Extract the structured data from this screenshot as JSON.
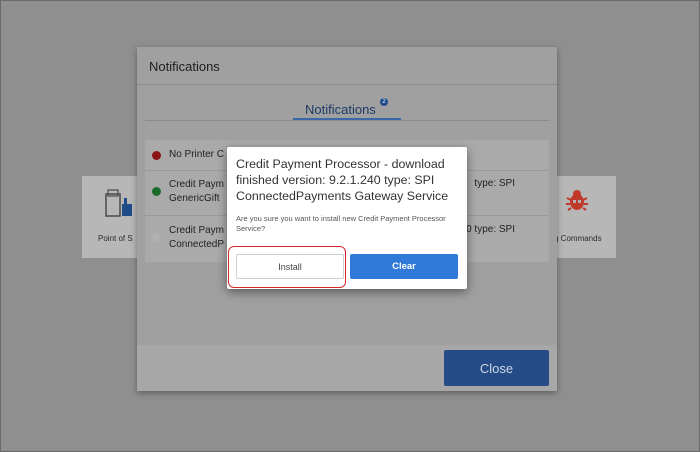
{
  "panel": {
    "title": "Notifications",
    "tab_label": "Notifications",
    "tab_badge": "2",
    "close_label": "Close",
    "rows": [
      {
        "text": "No Printer C",
        "right": "",
        "dot_color": "#8b1414"
      },
      {
        "text": "Credit Paym",
        "text2": "GenericGift",
        "right": "type: SPI",
        "dot_color": "#1b6b2a"
      },
      {
        "text": "Credit Paym",
        "text2": "ConnectedP",
        "right": "0 type: SPI",
        "dot_color": "#b0b0b0"
      }
    ]
  },
  "tiles": {
    "pos_label": "Point of S",
    "diag_label": "g Commands"
  },
  "modal": {
    "title": "Credit Payment Processor  - download finished version: 9.2.1.240 type: SPI ConnectedPayments Gateway Service",
    "message": "Are you sure you want to install new Credit Payment Processor Service?",
    "install_label": "Install",
    "clear_label": "Clear"
  },
  "colors": {
    "accent": "#2f79d8",
    "close_button": "#254c86",
    "highlight": "#d22a2a"
  },
  "icons": {
    "pos_tile": "printer-icon",
    "diag_tile": "bug-icon"
  }
}
